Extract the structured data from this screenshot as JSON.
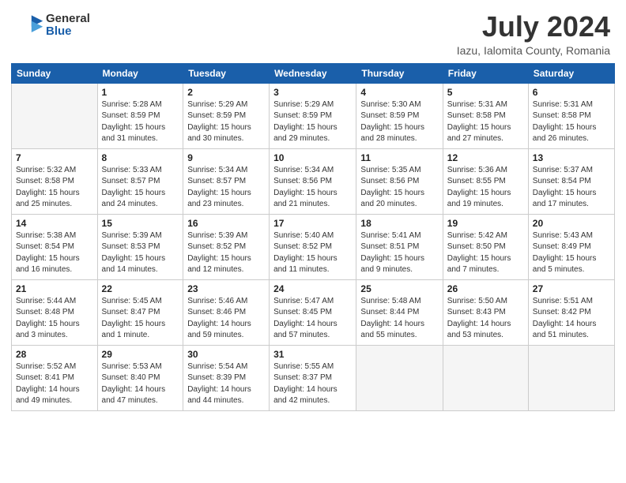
{
  "header": {
    "logo_general": "General",
    "logo_blue": "Blue",
    "month_title": "July 2024",
    "location": "Iazu, Ialomita County, Romania"
  },
  "days_of_week": [
    "Sunday",
    "Monday",
    "Tuesday",
    "Wednesday",
    "Thursday",
    "Friday",
    "Saturday"
  ],
  "weeks": [
    [
      {
        "num": "",
        "info": ""
      },
      {
        "num": "1",
        "info": "Sunrise: 5:28 AM\nSunset: 8:59 PM\nDaylight: 15 hours\nand 31 minutes."
      },
      {
        "num": "2",
        "info": "Sunrise: 5:29 AM\nSunset: 8:59 PM\nDaylight: 15 hours\nand 30 minutes."
      },
      {
        "num": "3",
        "info": "Sunrise: 5:29 AM\nSunset: 8:59 PM\nDaylight: 15 hours\nand 29 minutes."
      },
      {
        "num": "4",
        "info": "Sunrise: 5:30 AM\nSunset: 8:59 PM\nDaylight: 15 hours\nand 28 minutes."
      },
      {
        "num": "5",
        "info": "Sunrise: 5:31 AM\nSunset: 8:58 PM\nDaylight: 15 hours\nand 27 minutes."
      },
      {
        "num": "6",
        "info": "Sunrise: 5:31 AM\nSunset: 8:58 PM\nDaylight: 15 hours\nand 26 minutes."
      }
    ],
    [
      {
        "num": "7",
        "info": "Sunrise: 5:32 AM\nSunset: 8:58 PM\nDaylight: 15 hours\nand 25 minutes."
      },
      {
        "num": "8",
        "info": "Sunrise: 5:33 AM\nSunset: 8:57 PM\nDaylight: 15 hours\nand 24 minutes."
      },
      {
        "num": "9",
        "info": "Sunrise: 5:34 AM\nSunset: 8:57 PM\nDaylight: 15 hours\nand 23 minutes."
      },
      {
        "num": "10",
        "info": "Sunrise: 5:34 AM\nSunset: 8:56 PM\nDaylight: 15 hours\nand 21 minutes."
      },
      {
        "num": "11",
        "info": "Sunrise: 5:35 AM\nSunset: 8:56 PM\nDaylight: 15 hours\nand 20 minutes."
      },
      {
        "num": "12",
        "info": "Sunrise: 5:36 AM\nSunset: 8:55 PM\nDaylight: 15 hours\nand 19 minutes."
      },
      {
        "num": "13",
        "info": "Sunrise: 5:37 AM\nSunset: 8:54 PM\nDaylight: 15 hours\nand 17 minutes."
      }
    ],
    [
      {
        "num": "14",
        "info": "Sunrise: 5:38 AM\nSunset: 8:54 PM\nDaylight: 15 hours\nand 16 minutes."
      },
      {
        "num": "15",
        "info": "Sunrise: 5:39 AM\nSunset: 8:53 PM\nDaylight: 15 hours\nand 14 minutes."
      },
      {
        "num": "16",
        "info": "Sunrise: 5:39 AM\nSunset: 8:52 PM\nDaylight: 15 hours\nand 12 minutes."
      },
      {
        "num": "17",
        "info": "Sunrise: 5:40 AM\nSunset: 8:52 PM\nDaylight: 15 hours\nand 11 minutes."
      },
      {
        "num": "18",
        "info": "Sunrise: 5:41 AM\nSunset: 8:51 PM\nDaylight: 15 hours\nand 9 minutes."
      },
      {
        "num": "19",
        "info": "Sunrise: 5:42 AM\nSunset: 8:50 PM\nDaylight: 15 hours\nand 7 minutes."
      },
      {
        "num": "20",
        "info": "Sunrise: 5:43 AM\nSunset: 8:49 PM\nDaylight: 15 hours\nand 5 minutes."
      }
    ],
    [
      {
        "num": "21",
        "info": "Sunrise: 5:44 AM\nSunset: 8:48 PM\nDaylight: 15 hours\nand 3 minutes."
      },
      {
        "num": "22",
        "info": "Sunrise: 5:45 AM\nSunset: 8:47 PM\nDaylight: 15 hours\nand 1 minute."
      },
      {
        "num": "23",
        "info": "Sunrise: 5:46 AM\nSunset: 8:46 PM\nDaylight: 14 hours\nand 59 minutes."
      },
      {
        "num": "24",
        "info": "Sunrise: 5:47 AM\nSunset: 8:45 PM\nDaylight: 14 hours\nand 57 minutes."
      },
      {
        "num": "25",
        "info": "Sunrise: 5:48 AM\nSunset: 8:44 PM\nDaylight: 14 hours\nand 55 minutes."
      },
      {
        "num": "26",
        "info": "Sunrise: 5:50 AM\nSunset: 8:43 PM\nDaylight: 14 hours\nand 53 minutes."
      },
      {
        "num": "27",
        "info": "Sunrise: 5:51 AM\nSunset: 8:42 PM\nDaylight: 14 hours\nand 51 minutes."
      }
    ],
    [
      {
        "num": "28",
        "info": "Sunrise: 5:52 AM\nSunset: 8:41 PM\nDaylight: 14 hours\nand 49 minutes."
      },
      {
        "num": "29",
        "info": "Sunrise: 5:53 AM\nSunset: 8:40 PM\nDaylight: 14 hours\nand 47 minutes."
      },
      {
        "num": "30",
        "info": "Sunrise: 5:54 AM\nSunset: 8:39 PM\nDaylight: 14 hours\nand 44 minutes."
      },
      {
        "num": "31",
        "info": "Sunrise: 5:55 AM\nSunset: 8:37 PM\nDaylight: 14 hours\nand 42 minutes."
      },
      {
        "num": "",
        "info": ""
      },
      {
        "num": "",
        "info": ""
      },
      {
        "num": "",
        "info": ""
      }
    ]
  ]
}
